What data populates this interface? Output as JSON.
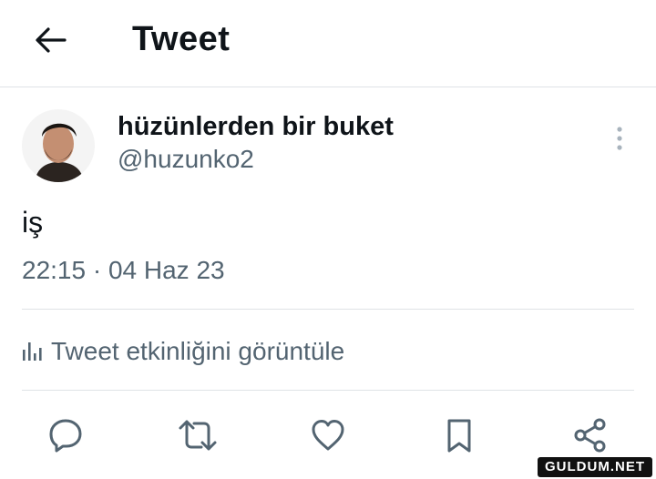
{
  "header": {
    "title": "Tweet",
    "back_icon": "arrow-left-icon"
  },
  "tweet": {
    "author": {
      "display_name": "hüzünlerden bir buket",
      "handle": "@huzunko2"
    },
    "text": "iş",
    "timestamp": "22:15 · 04 Haz 23",
    "analytics_label": "Tweet etkinliğini görüntüle"
  },
  "actions": [
    "reply-icon",
    "retweet-icon",
    "like-icon",
    "bookmark-icon",
    "share-icon"
  ],
  "watermark": "GULDUM.NET",
  "colors": {
    "text": "#0f1419",
    "secondary": "#536471",
    "divider": "#dfe3e6"
  }
}
